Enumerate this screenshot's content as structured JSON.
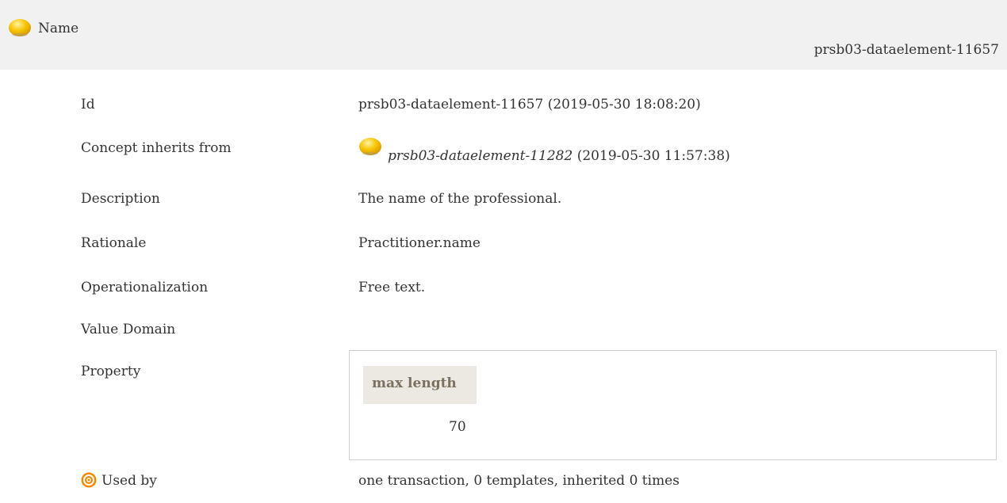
{
  "header": {
    "name": "Name",
    "id": "prsb03-dataelement-11657",
    "icon": "concept-draft-icon"
  },
  "rows": {
    "id": {
      "label": "Id",
      "value": "prsb03-dataelement-11657 (2019-05-30 18:08:20)"
    },
    "inherits": {
      "label": "Concept inherits from",
      "ref": "prsb03-dataelement-11282",
      "date": "(2019-05-30 11:57:38)"
    },
    "description": {
      "label": "Description",
      "value": "The name of the professional."
    },
    "rationale": {
      "label": "Rationale",
      "value": "Practitioner.name"
    },
    "operationalization": {
      "label": "Operationalization",
      "value": "Free text."
    },
    "value_domain": {
      "label": "Value Domain"
    },
    "property": {
      "label": "Property",
      "column_header": "max length",
      "column_value": "70"
    },
    "used_by": {
      "label": "Used by",
      "value": "one transaction, 0 templates, inherited 0 times"
    }
  },
  "colors": {
    "header_bg": "#f1f1f1",
    "prop_head_bg": "#ece9e3",
    "prop_head_text": "#7a7160",
    "status_yellow": "#f5c200",
    "target_orange": "#f08a00"
  }
}
